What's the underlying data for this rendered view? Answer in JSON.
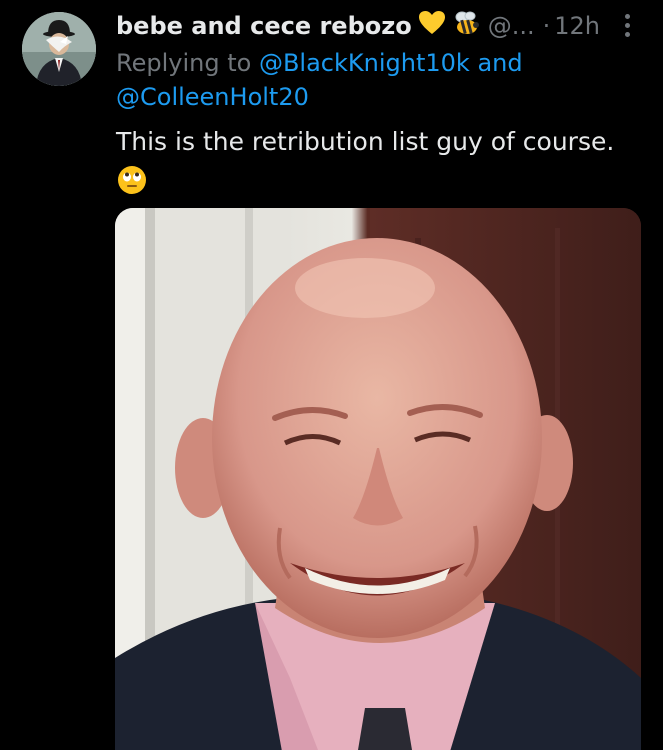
{
  "tweet": {
    "display_name": "bebe and cece rebozo",
    "handle": "@...",
    "separator": "·",
    "time": "12h",
    "replying_prefix": "Replying to",
    "mention_1": "@BlackKnight10k",
    "replying_and": "and",
    "mention_2": "@ColleenHolt20",
    "text": "This is the retribution list guy of course.",
    "name_emojis": [
      "yellow-heart",
      "bee"
    ],
    "text_emoji": "face-with-rolling-eyes",
    "media_alt": "photo of bald smiling man in suit and pink shirt"
  },
  "colors": {
    "background": "#000000",
    "primary_text": "#e7e9ea",
    "secondary_text": "#71767b",
    "link": "#1d9bf0"
  }
}
